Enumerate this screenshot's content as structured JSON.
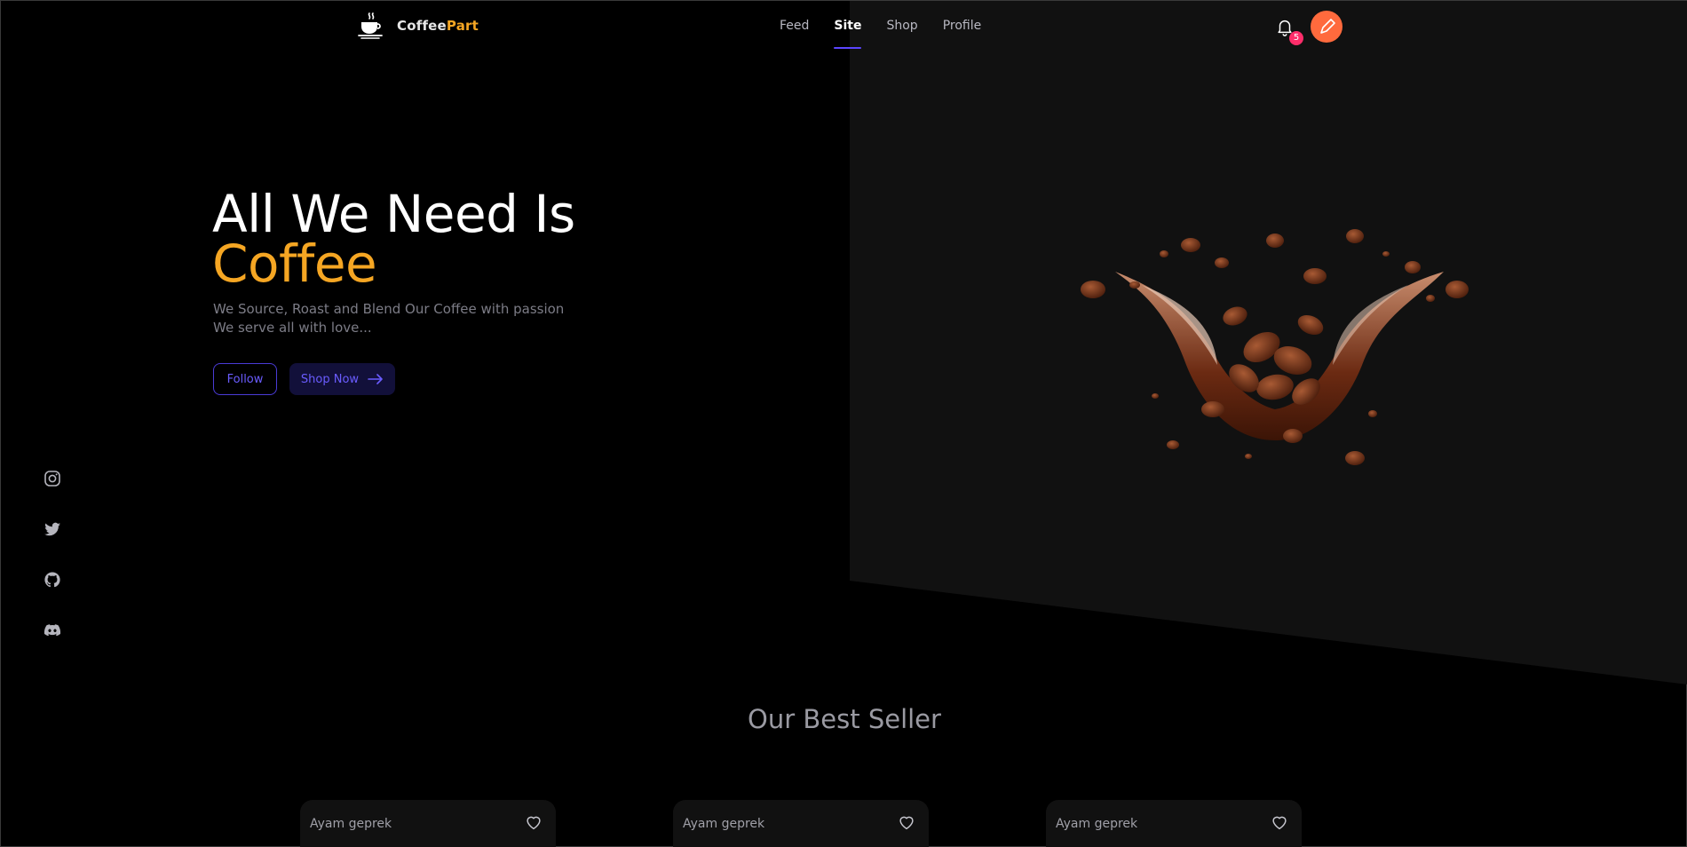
{
  "brand": {
    "name_part1": "Coffee",
    "name_part2": "Part",
    "icon": "coffee-cup-icon"
  },
  "nav": {
    "items": [
      {
        "label": "Feed",
        "active": false
      },
      {
        "label": "Site",
        "active": true
      },
      {
        "label": "Shop",
        "active": false
      },
      {
        "label": "Profile",
        "active": false
      }
    ]
  },
  "notifications": {
    "icon": "bell-icon",
    "count": "5"
  },
  "hero": {
    "title_line1": "All We Need Is",
    "title_line2": "Coffee",
    "subtitle_line1": "We Source, Roast and Blend Our Coffee with passion",
    "subtitle_line2": "We serve all with love...",
    "follow_label": "Follow",
    "shop_label": "Shop Now"
  },
  "socials": [
    "instagram-icon",
    "twitter-icon",
    "github-icon",
    "discord-icon"
  ],
  "best_seller": {
    "title": "Our Best Seller",
    "cards": [
      {
        "name": "Ayam geprek"
      },
      {
        "name": "Ayam geprek"
      },
      {
        "name": "Ayam geprek"
      }
    ]
  },
  "colors": {
    "accent": "#5b45ff",
    "brand_orange": "#f5a623",
    "badge": "#ff2d6a",
    "avatar": "#ff6a3d"
  }
}
